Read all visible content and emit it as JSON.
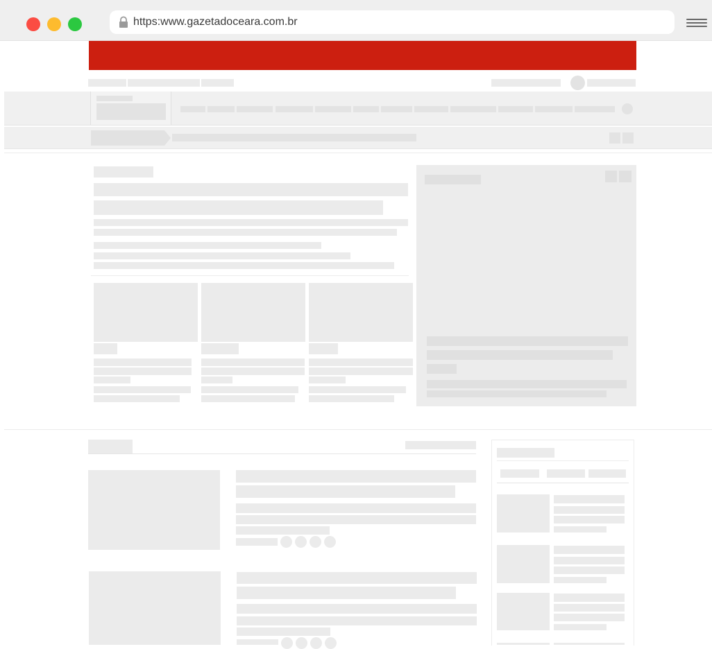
{
  "browser": {
    "url": "https:www.gazetadoceara.com.br",
    "lock_icon": "lock-icon",
    "menu_icon": "hamburger-menu-icon",
    "traffic_lights": [
      {
        "name": "close",
        "color": "#fb4c43"
      },
      {
        "name": "minimize",
        "color": "#fdbb2e"
      },
      {
        "name": "maximize",
        "color": "#2bc840"
      }
    ]
  },
  "site": {
    "brand_color": "#cc1f10",
    "placeholder_color": "#ebebeb",
    "background_color": "#ffffff"
  }
}
